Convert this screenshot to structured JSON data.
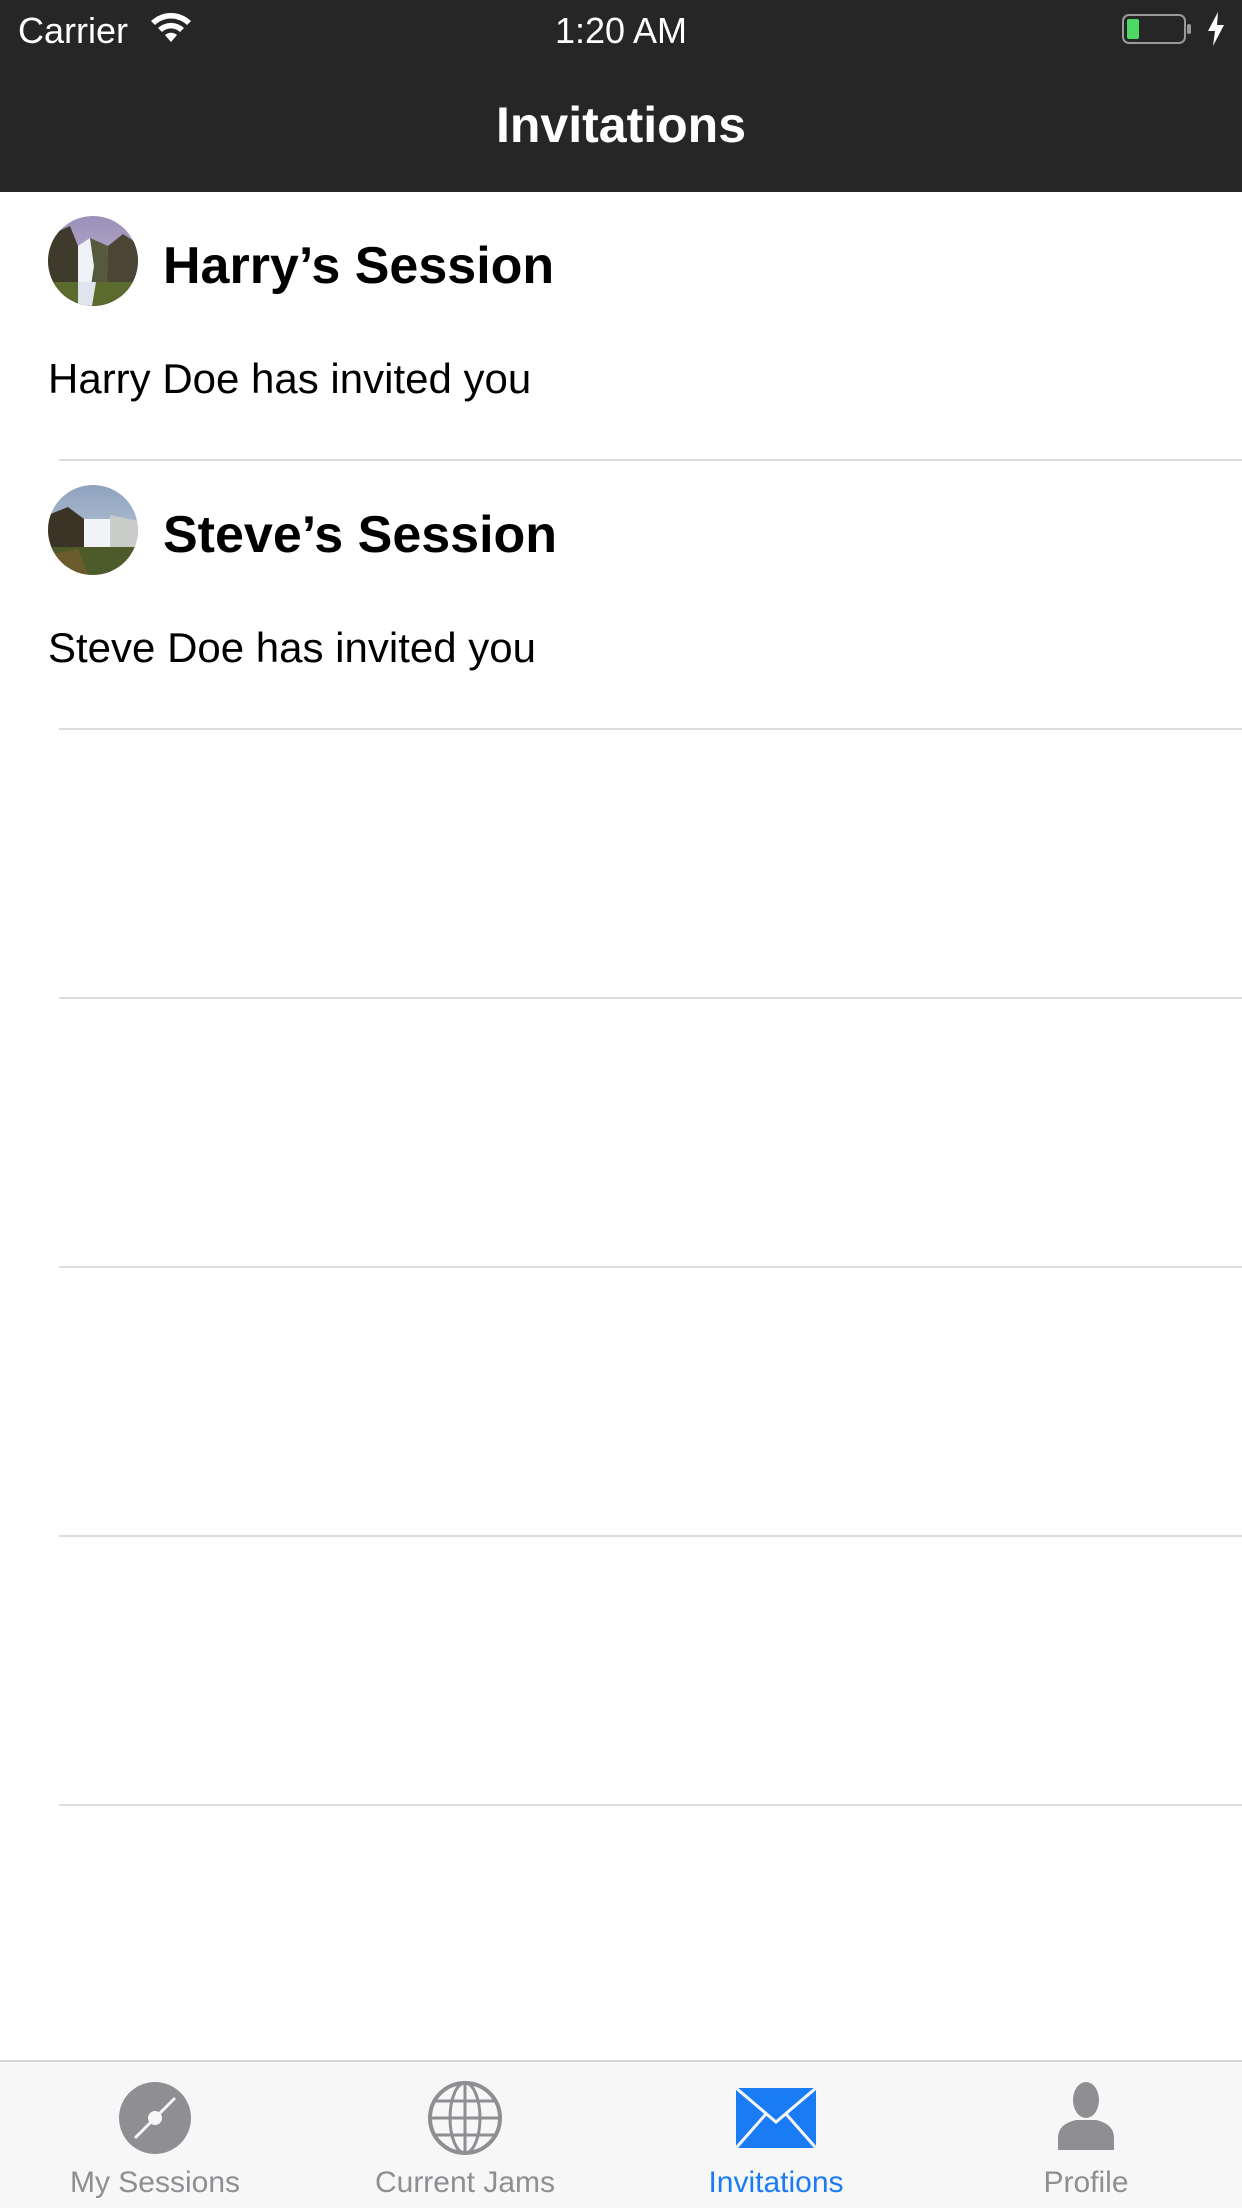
{
  "status_bar": {
    "carrier": "Carrier",
    "time": "1:20 AM"
  },
  "nav": {
    "title": "Invitations"
  },
  "invitations": [
    {
      "title": "Harry’s Session",
      "subtitle": "Harry Doe has invited you",
      "avatar_icon": "waterfall-photo"
    },
    {
      "title": "Steve’s Session",
      "subtitle": "Steve Doe has invited you",
      "avatar_icon": "waterfall-photo"
    }
  ],
  "tab_bar": {
    "tabs": [
      {
        "label": "My Sessions",
        "icon": "disc-icon"
      },
      {
        "label": "Current Jams",
        "icon": "globe-icon"
      },
      {
        "label": "Invitations",
        "icon": "envelope-icon",
        "selected": true
      },
      {
        "label": "Profile",
        "icon": "person-icon"
      }
    ]
  },
  "colors": {
    "nav_background": "#262626",
    "tab_active": "#1a7cf4",
    "tab_inactive": "#8e8e93",
    "battery_fill": "#4cd964"
  }
}
